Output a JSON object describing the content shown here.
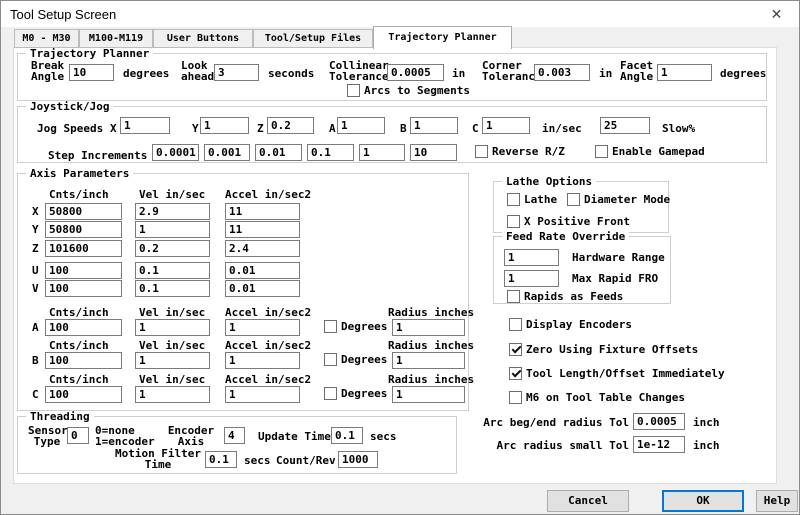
{
  "window": {
    "title": "Tool Setup Screen",
    "close_icon": "✕"
  },
  "colors": {
    "accent": "#0078d7",
    "window_bg": "#f0f0f0",
    "page_bg": "#ffffff"
  },
  "tabs": [
    "M0 - M30",
    "M100-M119",
    "User Buttons",
    "Tool/Setup Files",
    "Trajectory Planner"
  ],
  "active_tab": "Trajectory Planner",
  "tp": {
    "label": "Trajectory Planner",
    "break_label": "Break\nAngle",
    "break_value": "10",
    "break_unit": "degrees",
    "look_label": "Look\nahead",
    "look_value": "3",
    "look_unit": "seconds",
    "collinear_label": "Collinear\nTolerance",
    "collinear_value": "0.0005",
    "collinear_unit": "in",
    "corner_label": "Corner\nTolerance",
    "corner_value": "0.003",
    "corner_unit": "in",
    "facet_label": "Facet\nAngle",
    "facet_value": "1",
    "facet_unit": "degrees",
    "arcs_label": "Arcs to Segments",
    "arcs_checked": false
  },
  "jog": {
    "label": "Joystick/Jog",
    "speeds_label": "Jog Speeds",
    "axes": [
      {
        "label": "X",
        "value": "1"
      },
      {
        "label": "Y",
        "value": "1"
      },
      {
        "label": "Z",
        "value": "0.2"
      },
      {
        "label": "A",
        "value": "1"
      },
      {
        "label": "B",
        "value": "1"
      },
      {
        "label": "C",
        "value": "1"
      }
    ],
    "unit": "in/sec",
    "slow_value": "25",
    "slow_label": "Slow%",
    "steps_label": "Step Increments",
    "steps": [
      "0.0001",
      "0.001",
      "0.01",
      "0.1",
      "1",
      "10"
    ],
    "reverse_label": "Reverse R/Z",
    "reverse_checked": false,
    "gamepad_label": "Enable Gamepad",
    "gamepad_checked": false
  },
  "axis": {
    "label": "Axis Parameters",
    "headers": {
      "cnts": "Cnts/inch",
      "vel": "Vel in/sec",
      "accel": "Accel in/sec2",
      "radius": "Radius inches"
    },
    "degrees_label": "Degrees",
    "linear": [
      {
        "axis": "X",
        "cnts": "50800",
        "vel": "2.9",
        "accel": "11"
      },
      {
        "axis": "Y",
        "cnts": "50800",
        "vel": "1",
        "accel": "11"
      },
      {
        "axis": "Z",
        "cnts": "101600",
        "vel": "0.2",
        "accel": "2.4"
      },
      {
        "axis": "U",
        "cnts": "100",
        "vel": "0.1",
        "accel": "0.01"
      },
      {
        "axis": "V",
        "cnts": "100",
        "vel": "0.1",
        "accel": "0.01"
      }
    ],
    "rotary": [
      {
        "axis": "A",
        "cnts": "100",
        "vel": "1",
        "accel": "1",
        "degrees_checked": false,
        "radius": "1"
      },
      {
        "axis": "B",
        "cnts": "100",
        "vel": "1",
        "accel": "1",
        "degrees_checked": false,
        "radius": "1"
      },
      {
        "axis": "C",
        "cnts": "100",
        "vel": "1",
        "accel": "1",
        "degrees_checked": false,
        "radius": "1"
      }
    ]
  },
  "lathe": {
    "label": "Lathe Options",
    "lathe_label": "Lathe",
    "lathe_checked": false,
    "diameter_label": "Diameter Mode",
    "diameter_checked": false,
    "xpos_label": "X Positive Front",
    "xpos_checked": false
  },
  "fro": {
    "label": "Feed Rate Override",
    "hw_value": "1",
    "hw_label": "Hardware Range",
    "max_value": "1",
    "max_label": "Max Rapid FRO",
    "rapids_label": "Rapids as Feeds",
    "rapids_checked": false
  },
  "options": [
    {
      "label": "Display Encoders",
      "checked": false
    },
    {
      "label": "Zero Using Fixture Offsets",
      "checked": true
    },
    {
      "label": "Tool Length/Offset Immediately",
      "checked": true
    },
    {
      "label": "M6 on Tool Table Changes",
      "checked": false
    }
  ],
  "arc": {
    "beg_label": "Arc beg/end radius Tol",
    "beg_value": "0.0005",
    "beg_unit": "inch",
    "small_label": "Arc radius small Tol",
    "small_value": "1e-12",
    "small_unit": "inch"
  },
  "threading": {
    "label": "Threading",
    "sensor_label": "Sensor\nType",
    "sensor_value": "0",
    "sensor_note": "0=none\n1=encoder",
    "encoder_label": "Encoder\nAxis",
    "encoder_value": "4",
    "update_label": "Update Time",
    "update_value": "0.1",
    "update_unit": "secs",
    "filter_label": "Motion Filter\nTime",
    "filter_value": "0.1",
    "filter_unit": "secs",
    "count_label": "Count/Rev",
    "count_value": "1000"
  },
  "buttons": {
    "cancel": "Cancel",
    "ok": "OK",
    "help": "Help"
  }
}
